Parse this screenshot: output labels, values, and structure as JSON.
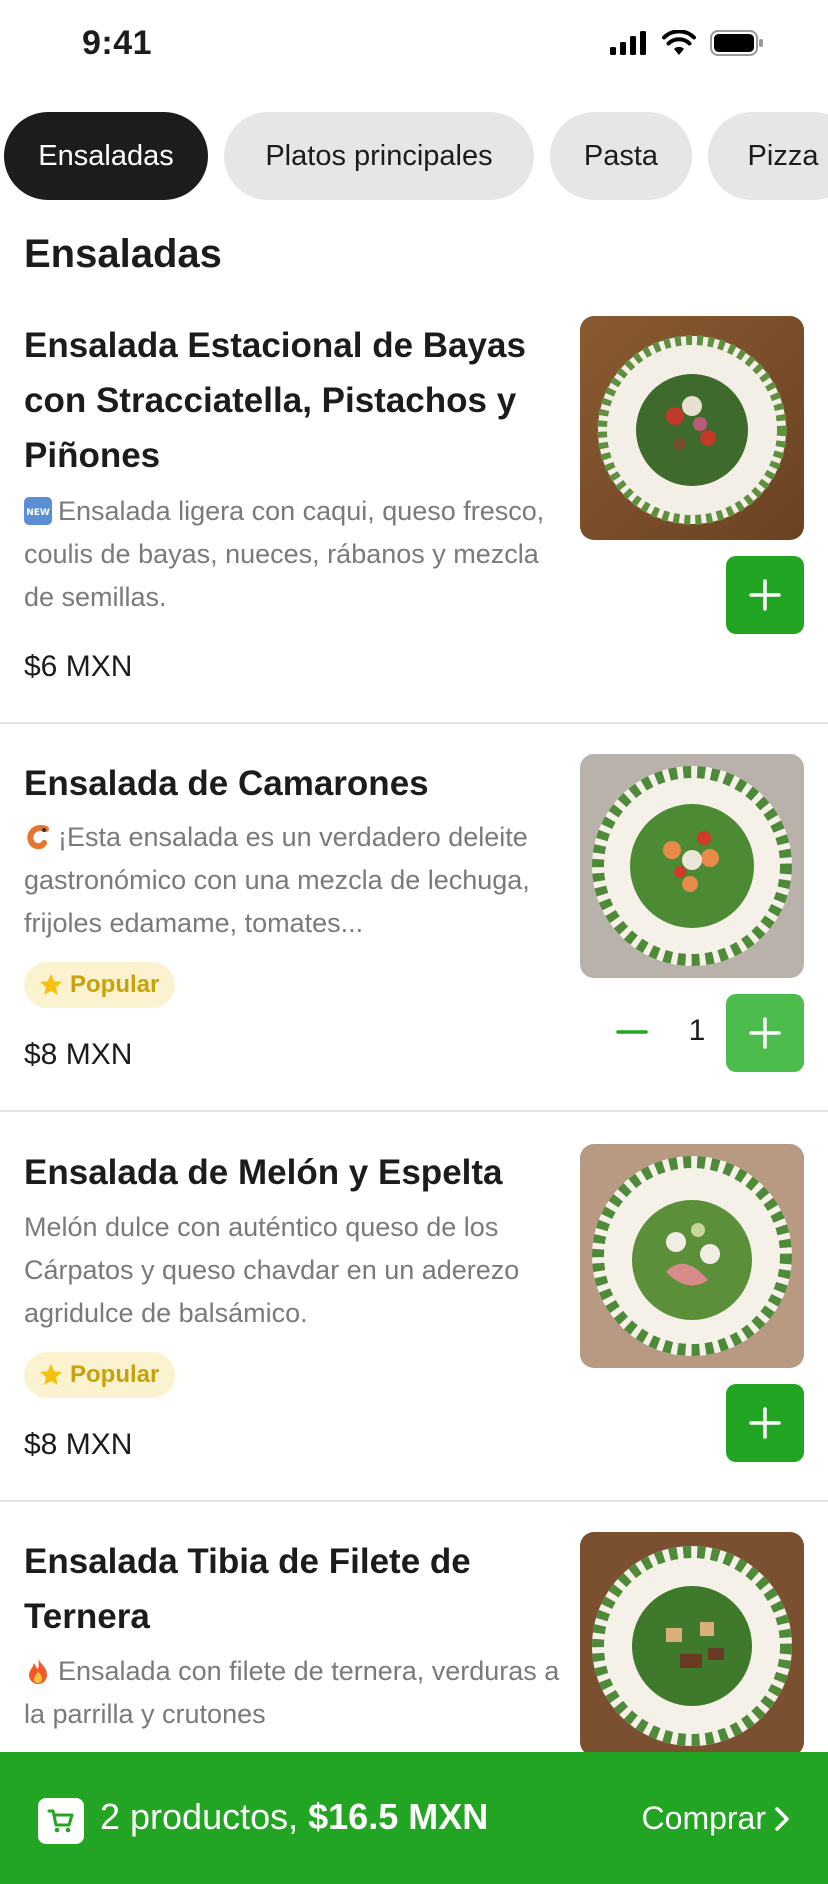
{
  "status_bar": {
    "time": "9:41"
  },
  "tabs": [
    {
      "label": "Ensaladas",
      "active": true
    },
    {
      "label": "Platos principales",
      "active": false
    },
    {
      "label": "Pasta",
      "active": false
    },
    {
      "label": "Pizza",
      "active": false
    }
  ],
  "section_title": "Ensaladas",
  "items": [
    {
      "name": "Ensalada Estacional de Bayas con Stracciatella, Pistachos y Piñones",
      "icon": "new-icon",
      "description": "Ensalada ligera con caqui, queso fresco, coulis de bayas, nueces, rábanos y mezcla de semillas.",
      "price": "$6 MXN"
    },
    {
      "name": "Ensalada de Camarones",
      "icon": "shrimp-icon",
      "description": "¡Esta ensalada es un verdadero deleite gastronómico con una mezcla de lechuga, frijoles edamame, tomates...",
      "badge": "Popular",
      "price": "$8 MXN",
      "quantity": "1"
    },
    {
      "name": "Ensalada de Melón y Espelta",
      "description": "Melón dulce con auténtico queso de los Cárpatos y queso chavdar en un aderezo agridulce de balsámico.",
      "badge": "Popular",
      "price": "$8 MXN"
    },
    {
      "name": "Ensalada Tibia de Filete de Ternera",
      "icon": "fire-icon",
      "description": "Ensalada con filete de ternera, verduras a la parrilla y crutones"
    }
  ],
  "cart": {
    "count_text": "2 productos,",
    "total": "$16.5 MXN",
    "checkout_label": "Comprar"
  },
  "colors": {
    "accent_green": "#22a523",
    "active_tab": "#1c1c1e",
    "inactive_tab": "#e6e6e6",
    "badge_bg": "#fbf3cf",
    "badge_text": "#c9a20a"
  }
}
